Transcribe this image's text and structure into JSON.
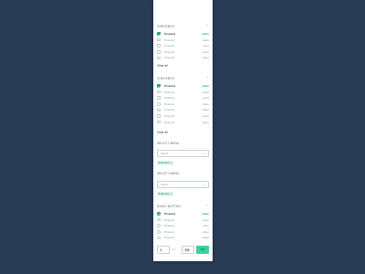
{
  "checkbox_section_1": {
    "title": "CHECKBOX",
    "items": [
      {
        "label": "Property",
        "value": "value",
        "checked": true
      },
      {
        "label": "Property",
        "value": "value",
        "checked": false
      },
      {
        "label": "Property",
        "value": "value",
        "checked": false
      },
      {
        "label": "Property",
        "value": "value",
        "checked": false
      },
      {
        "label": "Property",
        "value": "value",
        "checked": false
      }
    ],
    "clear_label": "Clear all"
  },
  "checkbox_section_2": {
    "title": "CHECKBOX",
    "items": [
      {
        "label": "Property",
        "value": "value",
        "checked": true
      },
      {
        "label": "Property",
        "value": "value",
        "checked": false
      },
      {
        "label": "Property",
        "value": "value",
        "checked": false
      },
      {
        "label": "Property",
        "value": "value",
        "checked": false
      },
      {
        "label": "Property",
        "value": "value",
        "checked": false
      },
      {
        "label": "Property",
        "value": "value",
        "checked": false
      },
      {
        "label": "Property",
        "value": "value",
        "checked": false
      }
    ],
    "clear_label": "Clear all"
  },
  "select_menu_1": {
    "title": "SELECT MENU",
    "placeholder": "Select...",
    "selection_tag": "Selection"
  },
  "select_menu_2": {
    "title": "SELECT MENU",
    "placeholder": "Select...",
    "selection_tag": "Selection"
  },
  "radio_section": {
    "title": "RADIO BUTTON",
    "items": [
      {
        "label": "Property",
        "value": "value",
        "checked": true
      },
      {
        "label": "Property",
        "value": "value",
        "checked": false
      },
      {
        "label": "Property",
        "value": "value",
        "checked": false
      },
      {
        "label": "Property",
        "value": "value",
        "checked": false
      },
      {
        "label": "Property",
        "value": "value",
        "checked": false
      }
    ]
  },
  "range": {
    "min_value": "$",
    "to_label": "to",
    "max_value": "$$$",
    "go_label": "Go"
  },
  "colors": {
    "background": "#283b55",
    "accent": "#27a886",
    "button": "#3bd399"
  },
  "icons": {
    "collapse": "chevron-up-icon",
    "dropdown": "chevron-down-icon",
    "remove": "close-icon"
  }
}
